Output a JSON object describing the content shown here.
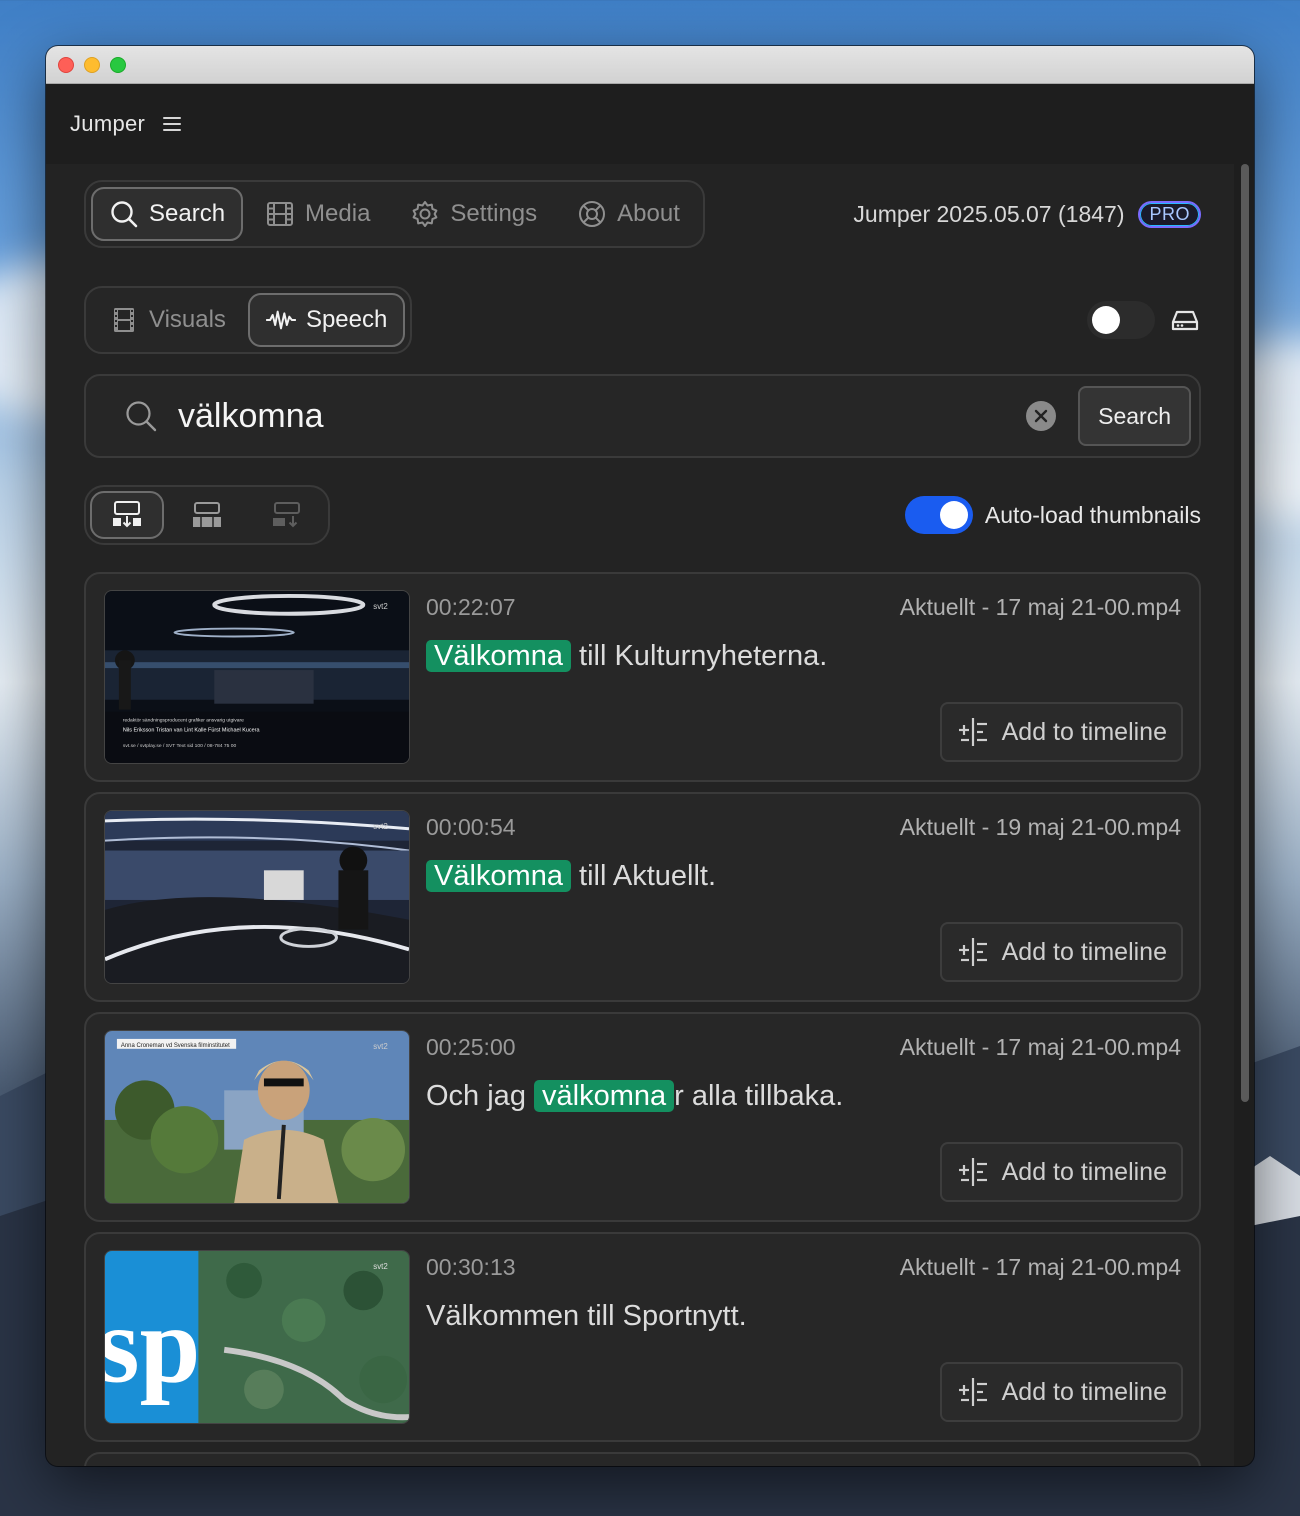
{
  "app": {
    "title": "Jumper",
    "version": "Jumper 2025.05.07 (1847)",
    "badge": "PRO"
  },
  "nav": {
    "tabs": [
      {
        "label": "Search",
        "icon": "search-icon",
        "active": true
      },
      {
        "label": "Media",
        "icon": "film-icon",
        "active": false
      },
      {
        "label": "Settings",
        "icon": "gear-icon",
        "active": false
      },
      {
        "label": "About",
        "icon": "lifebuoy-icon",
        "active": false
      }
    ]
  },
  "mode": {
    "tabs": [
      {
        "label": "Visuals",
        "icon": "film-strip-icon",
        "active": false
      },
      {
        "label": "Speech",
        "icon": "waveform-icon",
        "active": true
      }
    ],
    "toggle_on": false,
    "drive_icon": "hard-drive-icon"
  },
  "search": {
    "query": "välkomna",
    "button_label": "Search"
  },
  "view": {
    "auto_load_label": "Auto-load thumbnails",
    "auto_load_on": true
  },
  "results": [
    {
      "timecode": "00:22:07",
      "file": "Aktuellt - 17 maj 21-00.mp4",
      "before": "",
      "highlight": "Välkomna",
      "after": " till Kulturnyheterna.",
      "add_label": "Add to timeline"
    },
    {
      "timecode": "00:00:54",
      "file": "Aktuellt - 19 maj 21-00.mp4",
      "before": "",
      "highlight": "Välkomna",
      "after": " till Aktuellt.",
      "add_label": "Add to timeline"
    },
    {
      "timecode": "00:25:00",
      "file": "Aktuellt - 17 maj 21-00.mp4",
      "before": "Och jag ",
      "highlight": "välkomna",
      "after": "r alla tillbaka.",
      "add_label": "Add to timeline"
    },
    {
      "timecode": "00:30:13",
      "file": "Aktuellt - 17 maj 21-00.mp4",
      "before": "Välkommen till Sportnytt.",
      "highlight": "",
      "after": "",
      "add_label": "Add to timeline"
    }
  ],
  "colors": {
    "accent_blue": "#1a5cf0",
    "highlight_green": "#149060",
    "window_bg": "#1e1e1e"
  }
}
